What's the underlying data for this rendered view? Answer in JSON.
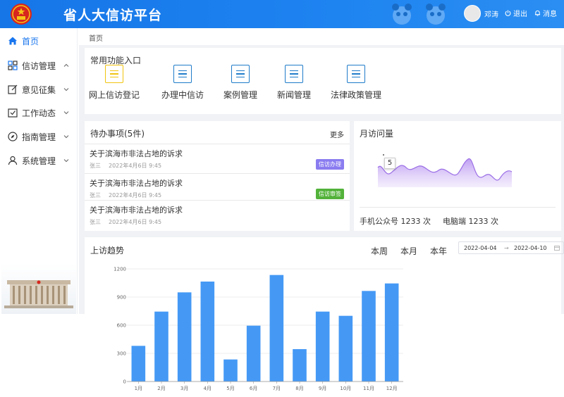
{
  "header": {
    "title": "省人大信访平台",
    "user_name": "邓涛",
    "logout_label": "退出",
    "message_label": "消息",
    "brand_color": "#1676e8"
  },
  "sidebar": {
    "items": [
      {
        "label": "首页",
        "icon": "home-icon",
        "active": true
      },
      {
        "label": "信访管理",
        "icon": "grid-icon",
        "expanded": true
      },
      {
        "label": "意见征集",
        "icon": "edit-icon"
      },
      {
        "label": "工作动态",
        "icon": "checkbox-icon"
      },
      {
        "label": "指南管理",
        "icon": "compass-icon"
      },
      {
        "label": "系统管理",
        "icon": "user-icon"
      }
    ]
  },
  "breadcrumb": "首页",
  "quick_access": {
    "title": "常用功能入口",
    "items": [
      {
        "label": "网上信访登记",
        "icon": "document-icon"
      },
      {
        "label": "办理中信访",
        "icon": "document-icon"
      },
      {
        "label": "案例管理",
        "icon": "document-icon"
      },
      {
        "label": "新闻管理",
        "icon": "document-icon"
      },
      {
        "label": "法律政策管理",
        "icon": "document-icon"
      }
    ]
  },
  "todo": {
    "title": "待办事项(5件)",
    "more_label": "更多",
    "items": [
      {
        "title": "关于滨海市非法占地的诉求",
        "person": "张三",
        "date": "2022年4月6日  9:45",
        "tag": "信访办理",
        "tag_color": "#8a7cf0"
      },
      {
        "title": "关于滨海市非法占地的诉求",
        "person": "张三",
        "date": "2022年4月6日  9:45",
        "tag": "信访审签",
        "tag_color": "#52b23a"
      },
      {
        "title": "关于滨海市非法占地的诉求",
        "person": "张三",
        "date": "2022年4月6日  9:45",
        "tag": "",
        "tag_color": ""
      }
    ]
  },
  "monthly": {
    "title": "月访问量",
    "tooltip_value": "5",
    "mobile_label": "手机公众号 1233 次",
    "pc_label": "电脑端 1233 次",
    "area_color": "#b48ef0"
  },
  "trend": {
    "title": "上访趋势",
    "range_week": "本周",
    "range_month": "本月",
    "range_year": "本年",
    "date_start": "2022-04-04",
    "date_sep": "→",
    "date_end": "2022-04-10",
    "bar_color": "#4599f5"
  },
  "chart_data": {
    "type": "bar",
    "categories": [
      "1月",
      "2月",
      "3月",
      "4月",
      "5月",
      "6月",
      "7月",
      "8月",
      "9月",
      "10月",
      "11月",
      "12月"
    ],
    "values": [
      380,
      745,
      950,
      1065,
      235,
      595,
      1135,
      345,
      745,
      700,
      965,
      1045
    ],
    "yticks": [
      0,
      300,
      600,
      900,
      1200
    ],
    "ylim": [
      0,
      1200
    ],
    "title": "",
    "xlabel": "",
    "ylabel": ""
  }
}
